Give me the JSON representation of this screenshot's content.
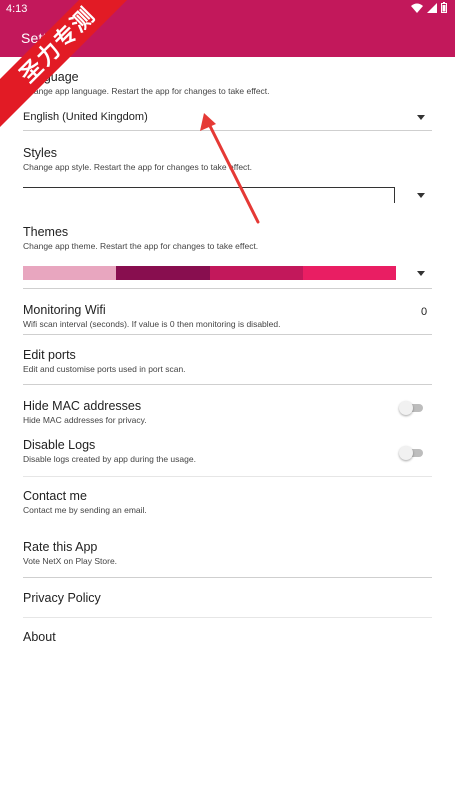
{
  "status_bar": {
    "time": "4:13"
  },
  "toolbar": {
    "title": "Settings"
  },
  "watermark": {
    "text": "圣力专测"
  },
  "preferences": {
    "language": {
      "title": "Language",
      "summary": "Change app language. Restart the app for changes to take effect.",
      "value": "English (United Kingdom)"
    },
    "styles": {
      "title": "Styles",
      "summary": "Change app style. Restart the app for changes to take effect.",
      "value": ""
    },
    "themes": {
      "title": "Themes",
      "summary": "Change app theme. Restart the app for changes to take effect.",
      "swatch_colors": [
        "#e8a6bf",
        "#880e4f",
        "#c2185b",
        "#e91e63"
      ]
    },
    "monitoring_wifi": {
      "title": "Monitoring Wifi",
      "summary": "Wifi scan interval (seconds). If value is 0 then monitoring is disabled.",
      "value": "0"
    },
    "edit_ports": {
      "title": "Edit ports",
      "summary": "Edit and customise ports used in port scan."
    },
    "hide_mac": {
      "title": "Hide MAC addresses",
      "summary": "Hide MAC addresses for privacy.",
      "enabled": false
    },
    "disable_logs": {
      "title": "Disable Logs",
      "summary": "Disable logs created by app during the usage.",
      "enabled": false
    },
    "contact_me": {
      "title": "Contact me",
      "summary": "Contact me by sending an email."
    },
    "rate_app": {
      "title": "Rate this App",
      "summary": "Vote NetX on Play Store."
    },
    "privacy_policy": {
      "title": "Privacy Policy"
    },
    "about": {
      "title": "About"
    }
  },
  "colors": {
    "accent": "#c2185b",
    "divider": "#cfcfcf",
    "annotation_arrow": "#e53935"
  }
}
